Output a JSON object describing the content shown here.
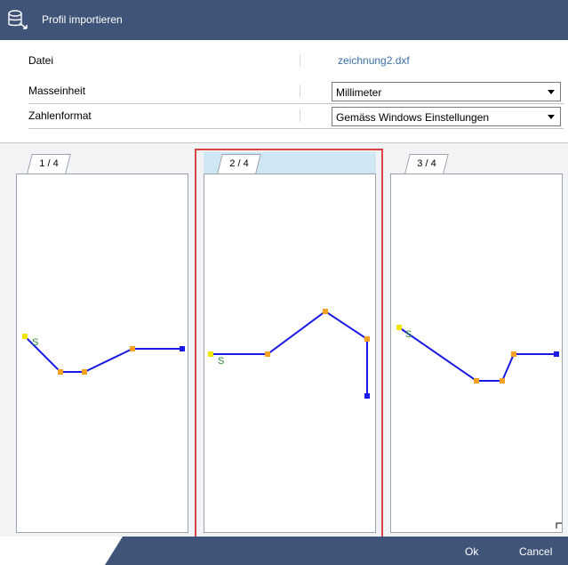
{
  "window": {
    "title": "Profil importieren",
    "icon": "database-import-icon"
  },
  "form": {
    "file": {
      "label": "Datei",
      "value": "zeichnung2.dxf"
    },
    "unit": {
      "label": "Masseinheit",
      "value": "Millimeter"
    },
    "number_format": {
      "label": "Zahlenformat",
      "value": "Gemäss Windows Einstellungen"
    }
  },
  "profiles": [
    {
      "tab": "1 / 4",
      "start_label": "S"
    },
    {
      "tab": "2 / 4",
      "start_label": "S",
      "selected": true
    },
    {
      "tab": "3 / 4",
      "start_label": "S"
    }
  ],
  "buttons": {
    "ok": "Ok",
    "cancel": "Cancel"
  },
  "colors": {
    "titlebar": "#3f5478",
    "selection": "#d94545",
    "line": "#1a1ae6",
    "node": "#f5a020",
    "start_node": "#f2e600",
    "end_node": "#1a1ae6",
    "start_label": "#2a8a2a"
  }
}
